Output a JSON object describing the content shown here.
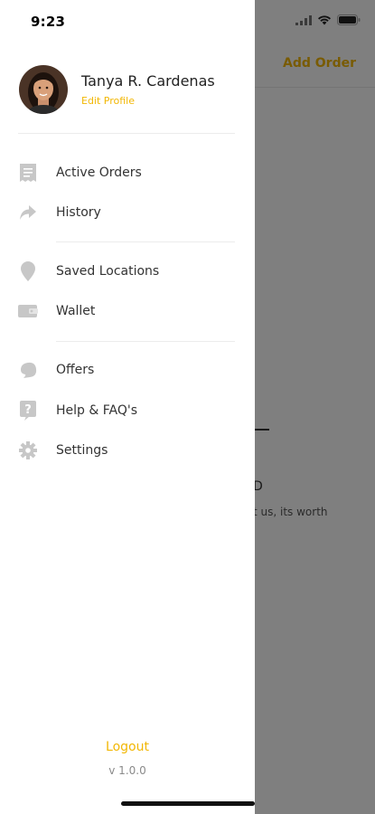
{
  "status_bar": {
    "time": "9:23"
  },
  "background": {
    "add_order_label": "Add Order",
    "partial_letter": "D",
    "partial_text": "t us, its worth"
  },
  "profile": {
    "name": "Tanya R. Cardenas",
    "edit_label": "Edit Profile"
  },
  "menu": {
    "groups": [
      [
        {
          "label": "Active Orders",
          "icon": "receipt-icon"
        },
        {
          "label": "History",
          "icon": "share-arrow-icon"
        }
      ],
      [
        {
          "label": "Saved Locations",
          "icon": "location-pin-icon"
        },
        {
          "label": "Wallet",
          "icon": "wallet-icon"
        }
      ],
      [
        {
          "label": "Offers",
          "icon": "offer-tag-icon"
        },
        {
          "label": "Help & FAQ's",
          "icon": "help-icon"
        },
        {
          "label": "Settings",
          "icon": "gear-icon"
        }
      ]
    ]
  },
  "footer": {
    "logout_label": "Logout",
    "version": "v 1.0.0"
  },
  "colors": {
    "accent": "#f2b705",
    "icon_gray": "#c7c7c7",
    "overlay": "rgba(0,0,0,0.5)"
  }
}
